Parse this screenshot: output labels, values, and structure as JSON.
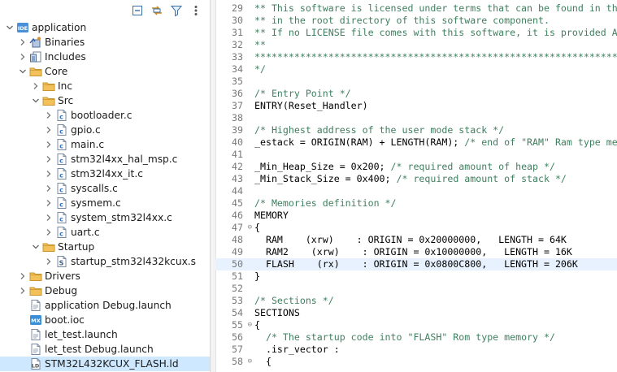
{
  "explorer": {
    "toolbar": [
      {
        "name": "collapse-all-icon"
      },
      {
        "name": "link-with-editor-icon"
      },
      {
        "name": "filter-icon"
      },
      {
        "name": "view-menu-icon"
      }
    ],
    "items": [
      {
        "label": "application",
        "depth": 0,
        "twisty": "open",
        "icon": "project-icon"
      },
      {
        "label": "Binaries",
        "depth": 1,
        "twisty": "closed",
        "icon": "binaries-icon"
      },
      {
        "label": "Includes",
        "depth": 1,
        "twisty": "closed",
        "icon": "includes-icon"
      },
      {
        "label": "Core",
        "depth": 1,
        "twisty": "open",
        "icon": "folder-icon"
      },
      {
        "label": "Inc",
        "depth": 2,
        "twisty": "closed",
        "icon": "folder-icon"
      },
      {
        "label": "Src",
        "depth": 2,
        "twisty": "open",
        "icon": "folder-icon"
      },
      {
        "label": "bootloader.c",
        "depth": 3,
        "twisty": "closed",
        "icon": "c-file-icon"
      },
      {
        "label": "gpio.c",
        "depth": 3,
        "twisty": "closed",
        "icon": "c-file-icon"
      },
      {
        "label": "main.c",
        "depth": 3,
        "twisty": "closed",
        "icon": "c-file-icon"
      },
      {
        "label": "stm32l4xx_hal_msp.c",
        "depth": 3,
        "twisty": "closed",
        "icon": "c-file-icon"
      },
      {
        "label": "stm32l4xx_it.c",
        "depth": 3,
        "twisty": "closed",
        "icon": "c-file-icon"
      },
      {
        "label": "syscalls.c",
        "depth": 3,
        "twisty": "closed",
        "icon": "c-file-icon"
      },
      {
        "label": "sysmem.c",
        "depth": 3,
        "twisty": "closed",
        "icon": "c-file-icon"
      },
      {
        "label": "system_stm32l4xx.c",
        "depth": 3,
        "twisty": "closed",
        "icon": "c-file-icon"
      },
      {
        "label": "uart.c",
        "depth": 3,
        "twisty": "closed",
        "icon": "c-file-icon"
      },
      {
        "label": "Startup",
        "depth": 2,
        "twisty": "open",
        "icon": "folder-icon"
      },
      {
        "label": "startup_stm32l432kcux.s",
        "depth": 3,
        "twisty": "closed",
        "icon": "asm-file-icon"
      },
      {
        "label": "Drivers",
        "depth": 1,
        "twisty": "closed",
        "icon": "folder-icon"
      },
      {
        "label": "Debug",
        "depth": 1,
        "twisty": "closed",
        "icon": "folder-icon"
      },
      {
        "label": "application Debug.launch",
        "depth": 1,
        "twisty": "none",
        "icon": "launch-file-icon"
      },
      {
        "label": "boot.ioc",
        "depth": 1,
        "twisty": "none",
        "icon": "ioc-file-icon"
      },
      {
        "label": "let_test.launch",
        "depth": 1,
        "twisty": "none",
        "icon": "launch-file-icon"
      },
      {
        "label": "let_test Debug.launch",
        "depth": 1,
        "twisty": "none",
        "icon": "launch-file-icon"
      },
      {
        "label": "STM32L432KCUX_FLASH.ld",
        "depth": 1,
        "twisty": "none",
        "icon": "ld-file-icon",
        "selected": true
      }
    ]
  },
  "editor": {
    "current_line": 50,
    "lines": [
      {
        "n": "29",
        "fold": "",
        "parts": [
          {
            "t": "** This software is licensed under terms that can be found in the LICENSE file",
            "c": true
          }
        ]
      },
      {
        "n": "30",
        "fold": "",
        "parts": [
          {
            "t": "** in the root directory of this software component.",
            "c": true
          }
        ]
      },
      {
        "n": "31",
        "fold": "",
        "parts": [
          {
            "t": "** If no LICENSE file comes with this software, it is provided AS-IS.",
            "c": true
          }
        ]
      },
      {
        "n": "32",
        "fold": "",
        "parts": [
          {
            "t": "**",
            "c": true
          }
        ]
      },
      {
        "n": "33",
        "fold": "",
        "parts": [
          {
            "t": "******************************************************************************",
            "c": true
          }
        ]
      },
      {
        "n": "34",
        "fold": "",
        "parts": [
          {
            "t": "*/",
            "c": true
          }
        ]
      },
      {
        "n": "35",
        "fold": "",
        "parts": []
      },
      {
        "n": "36",
        "fold": "",
        "parts": [
          {
            "t": "/* Entry Point */",
            "c": true
          }
        ]
      },
      {
        "n": "37",
        "fold": "",
        "parts": [
          {
            "t": "ENTRY(Reset_Handler)",
            "c": false
          }
        ]
      },
      {
        "n": "38",
        "fold": "",
        "parts": []
      },
      {
        "n": "39",
        "fold": "",
        "parts": [
          {
            "t": "/* Highest address of the user mode stack */",
            "c": true
          }
        ]
      },
      {
        "n": "40",
        "fold": "",
        "parts": [
          {
            "t": "_estack = ORIGIN(RAM) + LENGTH(RAM); ",
            "c": false
          },
          {
            "t": "/* end of \"RAM\" Ram type memory */",
            "c": true
          }
        ]
      },
      {
        "n": "41",
        "fold": "",
        "parts": []
      },
      {
        "n": "42",
        "fold": "",
        "parts": [
          {
            "t": "_Min_Heap_Size = 0x200; ",
            "c": false
          },
          {
            "t": "/* required amount of heap */",
            "c": true
          }
        ]
      },
      {
        "n": "43",
        "fold": "",
        "parts": [
          {
            "t": "_Min_Stack_Size = 0x400; ",
            "c": false
          },
          {
            "t": "/* required amount of stack */",
            "c": true
          }
        ]
      },
      {
        "n": "44",
        "fold": "",
        "parts": []
      },
      {
        "n": "45",
        "fold": "",
        "parts": [
          {
            "t": "/* Memories definition */",
            "c": true
          }
        ]
      },
      {
        "n": "46",
        "fold": "",
        "parts": [
          {
            "t": "MEMORY",
            "c": false
          }
        ]
      },
      {
        "n": "47",
        "fold": "⊖",
        "parts": [
          {
            "t": "{",
            "c": false
          }
        ]
      },
      {
        "n": "48",
        "fold": "",
        "parts": [
          {
            "t": "  RAM    (xrw)    : ORIGIN = 0x20000000,   LENGTH = 64K",
            "c": false
          }
        ]
      },
      {
        "n": "49",
        "fold": "",
        "parts": [
          {
            "t": "  RAM2    (xrw)    : ORIGIN = 0x10000000,   LENGTH = 16K",
            "c": false
          }
        ]
      },
      {
        "n": "50",
        "fold": "",
        "parts": [
          {
            "t": "  FLASH    (rx)    : ORIGIN = 0x0800C800,   LENGTH = 206K",
            "c": false
          }
        ]
      },
      {
        "n": "51",
        "fold": "",
        "parts": [
          {
            "t": "}",
            "c": false
          }
        ]
      },
      {
        "n": "52",
        "fold": "",
        "parts": []
      },
      {
        "n": "53",
        "fold": "",
        "parts": [
          {
            "t": "/* Sections */",
            "c": true
          }
        ]
      },
      {
        "n": "54",
        "fold": "",
        "parts": [
          {
            "t": "SECTIONS",
            "c": false
          }
        ]
      },
      {
        "n": "55",
        "fold": "⊖",
        "parts": [
          {
            "t": "{",
            "c": false
          }
        ]
      },
      {
        "n": "56",
        "fold": "",
        "parts": [
          {
            "t": "  ",
            "c": false
          },
          {
            "t": "/* The startup code into \"FLASH\" Rom type memory */",
            "c": true
          }
        ]
      },
      {
        "n": "57",
        "fold": "",
        "parts": [
          {
            "t": "  .isr_vector :",
            "c": false
          }
        ]
      },
      {
        "n": "58",
        "fold": "⊖",
        "parts": [
          {
            "t": "  {",
            "c": false
          }
        ]
      }
    ]
  }
}
